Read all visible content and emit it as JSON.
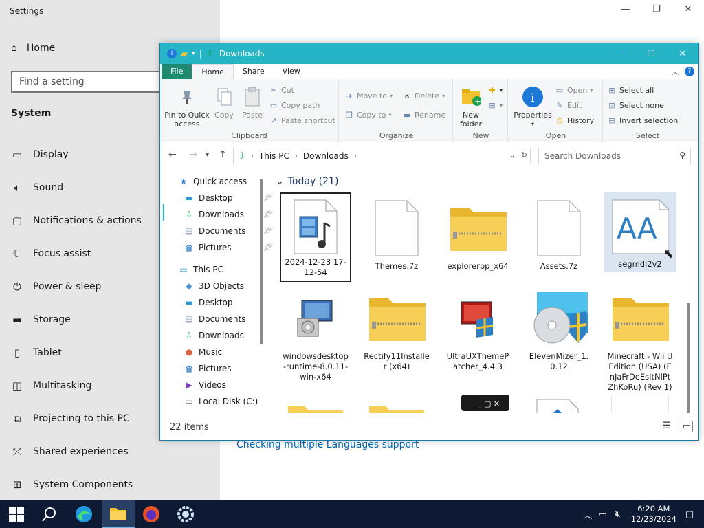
{
  "settings": {
    "title": "Settings",
    "home_label": "Home",
    "search_placeholder": "Find a setting",
    "section": "System",
    "items": [
      {
        "label": "Display",
        "icon": "monitor-icon"
      },
      {
        "label": "Sound",
        "icon": "speaker-icon"
      },
      {
        "label": "Notifications & actions",
        "icon": "notification-icon"
      },
      {
        "label": "Focus assist",
        "icon": "moon-icon"
      },
      {
        "label": "Power & sleep",
        "icon": "power-icon"
      },
      {
        "label": "Storage",
        "icon": "storage-icon"
      },
      {
        "label": "Tablet",
        "icon": "tablet-icon"
      },
      {
        "label": "Multitasking",
        "icon": "multitasking-icon"
      },
      {
        "label": "Projecting to this PC",
        "icon": "projector-icon"
      },
      {
        "label": "Shared experiences",
        "icon": "shared-icon"
      },
      {
        "label": "System Components",
        "icon": "components-icon"
      }
    ],
    "link": "Checking multiple Languages support"
  },
  "explorer": {
    "title": "Downloads",
    "tabs": {
      "file": "File",
      "home": "Home",
      "share": "Share",
      "view": "View"
    },
    "ribbon": {
      "clipboard": {
        "label": "Clipboard",
        "pin": "Pin to Quick access",
        "copy": "Copy",
        "paste": "Paste",
        "cut": "Cut",
        "copy_path": "Copy path",
        "paste_shortcut": "Paste shortcut"
      },
      "organize": {
        "label": "Organize",
        "move_to": "Move to",
        "copy_to": "Copy to",
        "delete": "Delete",
        "rename": "Rename"
      },
      "new": {
        "label": "New",
        "new_folder": "New folder"
      },
      "open": {
        "label": "Open",
        "properties": "Properties",
        "open": "Open",
        "edit": "Edit",
        "history": "History"
      },
      "select": {
        "label": "Select",
        "select_all": "Select all",
        "select_none": "Select none",
        "invert_selection": "Invert selection"
      }
    },
    "address": {
      "this_pc": "This PC",
      "downloads": "Downloads"
    },
    "search_placeholder": "Search Downloads",
    "nav": {
      "quick_access": "Quick access",
      "quick_items": [
        "Desktop",
        "Downloads",
        "Documents",
        "Pictures"
      ],
      "this_pc": "This PC",
      "pc_items": [
        "3D Objects",
        "Desktop",
        "Documents",
        "Downloads",
        "Music",
        "Pictures",
        "Videos",
        "Local Disk (C:)"
      ]
    },
    "group_heading": "Today (21)",
    "files": [
      {
        "name": "2024-12-23 17-12-54",
        "icon": "video-file-icon"
      },
      {
        "name": "Themes.7z",
        "icon": "blank-file-icon"
      },
      {
        "name": "explorerpp_x64",
        "icon": "zip-folder-icon"
      },
      {
        "name": "Assets.7z",
        "icon": "blank-file-icon"
      },
      {
        "name": "segmdl2v2",
        "icon": "font-file-icon"
      },
      {
        "name": "windowsdesktop-runtime-8.0.11-win-x64",
        "icon": "installer-icon"
      },
      {
        "name": "Rectify11Installer (x64)",
        "icon": "zip-folder-icon"
      },
      {
        "name": "UltraUXThemePatcher_4.4.3",
        "icon": "installer-icon"
      },
      {
        "name": "ElevenMizer_1.0.12",
        "icon": "installer-disc-icon"
      },
      {
        "name": "Minecraft - Wii U Edition (USA) (EnJaFrDeEsItNlPtZhKoRu) (Rev 1)",
        "icon": "zip-folder-icon"
      }
    ],
    "status": "22 items"
  },
  "taskbar": {
    "time": "6:20 AM",
    "date": "12/23/2024"
  }
}
